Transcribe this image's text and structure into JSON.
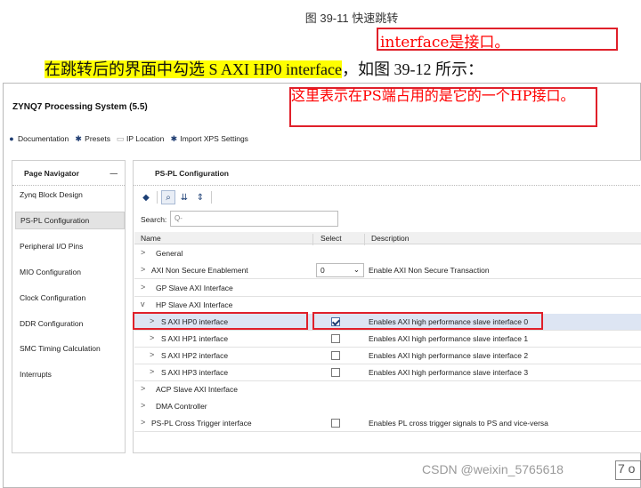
{
  "document": {
    "figure_caption": "图 39-11  快速跳转",
    "body_text_highlight": "在跳转后的界面中勾选 S AXI HP0 interface",
    "body_text_rest": "，如图 39-12 所示："
  },
  "annotations": {
    "top_note": "interface是接口。",
    "window_note": "这里表示在PS端占用的是它的一个HP接口。",
    "color": "#ff0000"
  },
  "window": {
    "title": "ZYNQ7 Processing System (5.5)",
    "toolbar": [
      {
        "icon": "info-icon",
        "label": "Documentation"
      },
      {
        "icon": "gear-icon",
        "label": "Presets"
      },
      {
        "icon": "folder-icon",
        "label": "IP Location"
      },
      {
        "icon": "gear-icon",
        "label": "Import XPS Settings"
      }
    ]
  },
  "nav": {
    "header": "Page Navigator",
    "collapse_symbol": "—",
    "items": [
      "Zynq Block Design",
      "PS-PL Configuration",
      "Peripheral I/O Pins",
      "MIO Configuration",
      "Clock Configuration",
      "DDR Configuration",
      "SMC Timing Calculation",
      "Interrupts"
    ],
    "selected": "PS-PL Configuration"
  },
  "panel": {
    "title": "PS-PL Configuration",
    "search_label": "Search:",
    "search_placeholder": "Q-",
    "columns": [
      "Name",
      "Select",
      "Description"
    ],
    "rows": [
      {
        "name": "General",
        "chevron": ">",
        "select": "",
        "desc": ""
      },
      {
        "name": "AXI Non Secure Enablement",
        "chevron": ">",
        "select": "0",
        "desc": "Enable AXI Non Secure Transaction"
      },
      {
        "name": "GP Slave AXI Interface",
        "chevron": ">",
        "select": "",
        "desc": ""
      },
      {
        "name": "HP Slave AXI Interface",
        "chevron": "v",
        "select": "",
        "desc": ""
      },
      {
        "name": "S AXI HP0 interface",
        "chevron": ">",
        "select": "checked",
        "desc": "Enables AXI high performance slave interface 0"
      },
      {
        "name": "S AXI HP1 interface",
        "chevron": ">",
        "select": "unchecked",
        "desc": "Enables AXI high performance slave interface 1"
      },
      {
        "name": "S AXI HP2 interface",
        "chevron": ">",
        "select": "unchecked",
        "desc": "Enables AXI high performance slave interface 2"
      },
      {
        "name": "S AXI HP3 interface",
        "chevron": ">",
        "select": "unchecked",
        "desc": "Enables AXI high performance slave interface 3"
      },
      {
        "name": "ACP Slave AXI Interface",
        "chevron": ">",
        "select": "",
        "desc": ""
      },
      {
        "name": "DMA Controller",
        "chevron": ">",
        "select": "",
        "desc": ""
      },
      {
        "name": "PS-PL Cross Trigger interface",
        "chevron": ">",
        "select": "unchecked",
        "desc": "Enables PL cross trigger signals to PS and vice-versa"
      }
    ]
  },
  "watermark": "CSDN @weixin_5765618",
  "watermark_box": "7 o"
}
